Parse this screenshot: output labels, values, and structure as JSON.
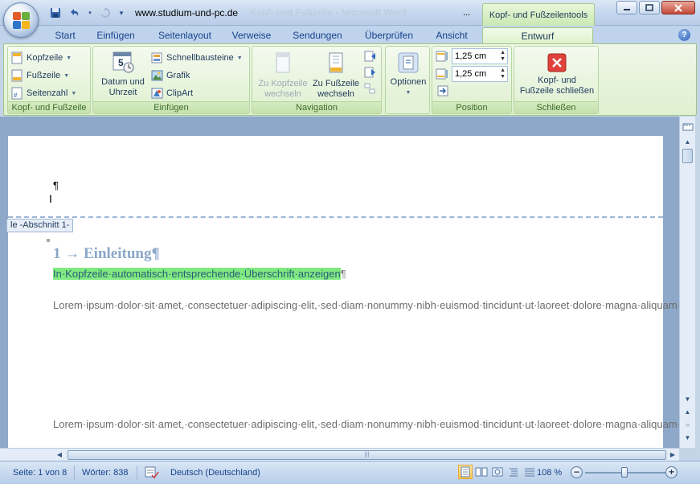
{
  "title_bar": {
    "url_title": "www.studium-und-pc.de",
    "blurred_title": "Kopf- und Fußzeile - Microsoft Word",
    "ellipsis": "...",
    "context_tool": "Kopf- und Fußzeilentools"
  },
  "tabs": [
    "Start",
    "Einfügen",
    "Seitenlayout",
    "Verweise",
    "Sendungen",
    "Überprüfen",
    "Ansicht",
    "Entwurf"
  ],
  "active_tab": "Entwurf",
  "ribbon": {
    "group1": {
      "label": "Kopf- und Fußzeile",
      "items": [
        "Kopfzeile",
        "Fußzeile",
        "Seitenzahl"
      ]
    },
    "group2": {
      "label": "Einfügen",
      "datum_line1": "Datum und",
      "datum_line2": "Uhrzeit",
      "items": [
        "Schnellbausteine",
        "Grafik",
        "ClipArt"
      ]
    },
    "group3": {
      "label": "Navigation",
      "zu_kopf_line1": "Zu Kopfzeile",
      "zu_kopf_line2": "wechseln",
      "zu_fuss_line1": "Zu Fußzeile",
      "zu_fuss_line2": "wechseln"
    },
    "group4": {
      "optionen": "Optionen"
    },
    "group5": {
      "label": "Position",
      "header_pos": "1,25 cm",
      "footer_pos": "1,25 cm"
    },
    "group6": {
      "label": "Schließen",
      "close_line1": "Kopf- und",
      "close_line2": "Fußzeile schließen"
    }
  },
  "document": {
    "header_tag": "le -Abschnitt 1-",
    "header_pilcrow": "¶",
    "heading": "1 → Einleitung¶",
    "highlight_text": "In·Kopfzeile·automatisch·entsprechende·Überschrift·anzeigen",
    "highlight_pilcrow": "¶",
    "paragraph1": "Lorem·ipsum·dolor·sit·amet,·consectetuer·adipiscing·elit,·sed·diam·nonummy·nibh·euismod·tincidunt·ut·laoreet·dolore·magna·aliquam·erat·volutpat.·Ut·wisi·enim·ad·minim·veniam,·quis·nostrud·exerci·tation·ullamcorper·suscipit·lobortis·nisl·ut·aliquip·ex·ea·commodo·consequat.·Duis·autem·vel·eum·iriure·dolor·in·hendrerit·in·vulputate·velit·esse·molestie·consequat,·vel·illum·dolore·eu·feugiat·nulla·facilisis·at·vero·et·accumsan·et·iusto·odio·dignissim·qui·blandit·praesent·luptatum·zzril·delenit·augue·duis·dolore·te·feugait·nulla·facilisi.·¶",
    "paragraph2": "Lorem·ipsum·dolor·sit·amet,·consectetuer·adipiscing·elit,·sed·diam·nonummy·nibh·euismod·tincidunt·ut·laoreet·dolore·magna·aliquam·erat·volutpat.·¶"
  },
  "status_bar": {
    "page": "Seite: 1 von 8",
    "words": "Wörter: 838",
    "language": "Deutsch (Deutschland)",
    "zoom": "108 %"
  },
  "colors": {
    "accent_green": "#dff0d0",
    "highlight": "#80ea80",
    "heading_color": "#8aa7c8"
  }
}
